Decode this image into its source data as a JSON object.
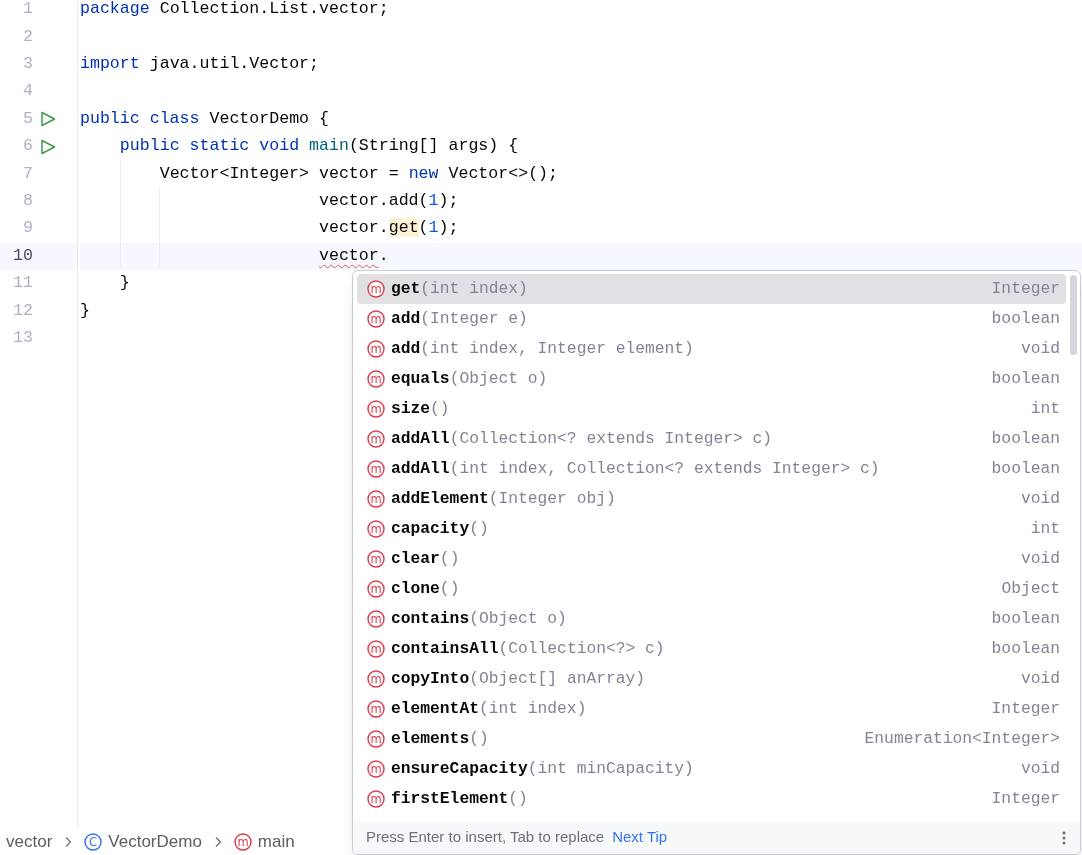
{
  "code_lines": [
    {
      "number": "1",
      "run_icon": false,
      "current": false,
      "tokens": [
        {
          "text": "package",
          "kind": "keyword"
        },
        {
          "text": " Collection.List.vector;",
          "kind": "plain"
        }
      ]
    },
    {
      "number": "2",
      "run_icon": false,
      "current": false
    },
    {
      "number": "3",
      "run_icon": false,
      "current": false,
      "tokens": [
        {
          "text": "import",
          "kind": "keyword"
        },
        {
          "text": " java.util.Vector;",
          "kind": "plain"
        }
      ]
    },
    {
      "number": "4",
      "run_icon": false,
      "current": false
    },
    {
      "number": "5",
      "run_icon": true,
      "current": false,
      "tokens": [
        {
          "text": "public class",
          "kind": "keyword"
        },
        {
          "text": " VectorDemo {",
          "kind": "plain"
        }
      ]
    },
    {
      "number": "6",
      "run_icon": true,
      "current": false,
      "tokens": [
        {
          "text": "    public static void",
          "kind": "keyword"
        },
        {
          "text": " main",
          "kind": "method"
        },
        {
          "text": "(String[] args) {",
          "kind": "plain"
        }
      ]
    },
    {
      "number": "7",
      "run_icon": false,
      "current": false,
      "tokens": [
        {
          "text": "        Vector<Integer> vector = ",
          "kind": "plain"
        },
        {
          "text": "new",
          "kind": "keyword"
        },
        {
          "text": " Vector<>();",
          "kind": "plain"
        }
      ]
    },
    {
      "number": "8",
      "run_icon": false,
      "current": false,
      "tokens": [
        {
          "text": "                        vector.add(",
          "kind": "plain"
        },
        {
          "text": "1",
          "kind": "number"
        },
        {
          "text": ");",
          "kind": "plain"
        }
      ]
    },
    {
      "number": "9",
      "run_icon": false,
      "current": false,
      "tokens": [
        {
          "text": "                        vector.",
          "kind": "plain"
        },
        {
          "text": "get",
          "kind": "highlight"
        },
        {
          "text": "(",
          "kind": "plain"
        },
        {
          "text": "1",
          "kind": "number"
        },
        {
          "text": ");",
          "kind": "plain"
        }
      ]
    },
    {
      "number": "10",
      "run_icon": false,
      "current": true,
      "tokens": [
        {
          "text": "                        vector",
          "kind": "error"
        },
        {
          "text": ".",
          "kind": "plain"
        }
      ]
    },
    {
      "number": "11",
      "run_icon": false,
      "current": false,
      "tokens": [
        {
          "text": "    }",
          "kind": "plain"
        }
      ]
    },
    {
      "number": "12",
      "run_icon": false,
      "current": false,
      "tokens": [
        {
          "text": "}",
          "kind": "plain"
        }
      ]
    },
    {
      "number": "13",
      "run_icon": false,
      "current": false
    }
  ],
  "completion_popup": {
    "items": [
      {
        "icon": "m",
        "name": "get",
        "params": "(int index)",
        "type": "Integer",
        "selected": true
      },
      {
        "icon": "m",
        "name": "add",
        "params": "(Integer e)",
        "type": "boolean",
        "selected": false
      },
      {
        "icon": "m",
        "name": "add",
        "params": "(int index, Integer element)",
        "type": "void",
        "selected": false
      },
      {
        "icon": "m",
        "name": "equals",
        "params": "(Object o)",
        "type": "boolean",
        "selected": false
      },
      {
        "icon": "m",
        "name": "size",
        "params": "()",
        "type": "int",
        "selected": false
      },
      {
        "icon": "m",
        "name": "addAll",
        "params": "(Collection<? extends Integer> c)",
        "type": "boolean",
        "selected": false
      },
      {
        "icon": "m",
        "name": "addAll",
        "params": "(int index, Collection<? extends Integer> c)",
        "type": "boolean",
        "selected": false
      },
      {
        "icon": "m",
        "name": "addElement",
        "params": "(Integer obj)",
        "type": "void",
        "selected": false
      },
      {
        "icon": "m",
        "name": "capacity",
        "params": "()",
        "type": "int",
        "selected": false
      },
      {
        "icon": "m",
        "name": "clear",
        "params": "()",
        "type": "void",
        "selected": false
      },
      {
        "icon": "m",
        "name": "clone",
        "params": "()",
        "type": "Object",
        "selected": false
      },
      {
        "icon": "m",
        "name": "contains",
        "params": "(Object o)",
        "type": "boolean",
        "selected": false
      },
      {
        "icon": "m",
        "name": "containsAll",
        "params": "(Collection<?> c)",
        "type": "boolean",
        "selected": false
      },
      {
        "icon": "m",
        "name": "copyInto",
        "params": "(Object[] anArray)",
        "type": "void",
        "selected": false
      },
      {
        "icon": "m",
        "name": "elementAt",
        "params": "(int index)",
        "type": "Integer",
        "selected": false
      },
      {
        "icon": "m",
        "name": "elements",
        "params": "()",
        "type": "Enumeration<Integer>",
        "selected": false
      },
      {
        "icon": "m",
        "name": "ensureCapacity",
        "params": "(int minCapacity)",
        "type": "void",
        "selected": false
      },
      {
        "icon": "m",
        "name": "firstElement",
        "params": "()",
        "type": "Integer",
        "selected": false
      }
    ],
    "footer": {
      "hint": "Press Enter to insert, Tab to replace",
      "link": "Next Tip"
    }
  },
  "breadcrumbs": [
    {
      "kind": "package",
      "label": "vector"
    },
    {
      "kind": "class",
      "icon": "C",
      "label": "VectorDemo"
    },
    {
      "kind": "method",
      "icon": "m",
      "label": "main"
    }
  ]
}
